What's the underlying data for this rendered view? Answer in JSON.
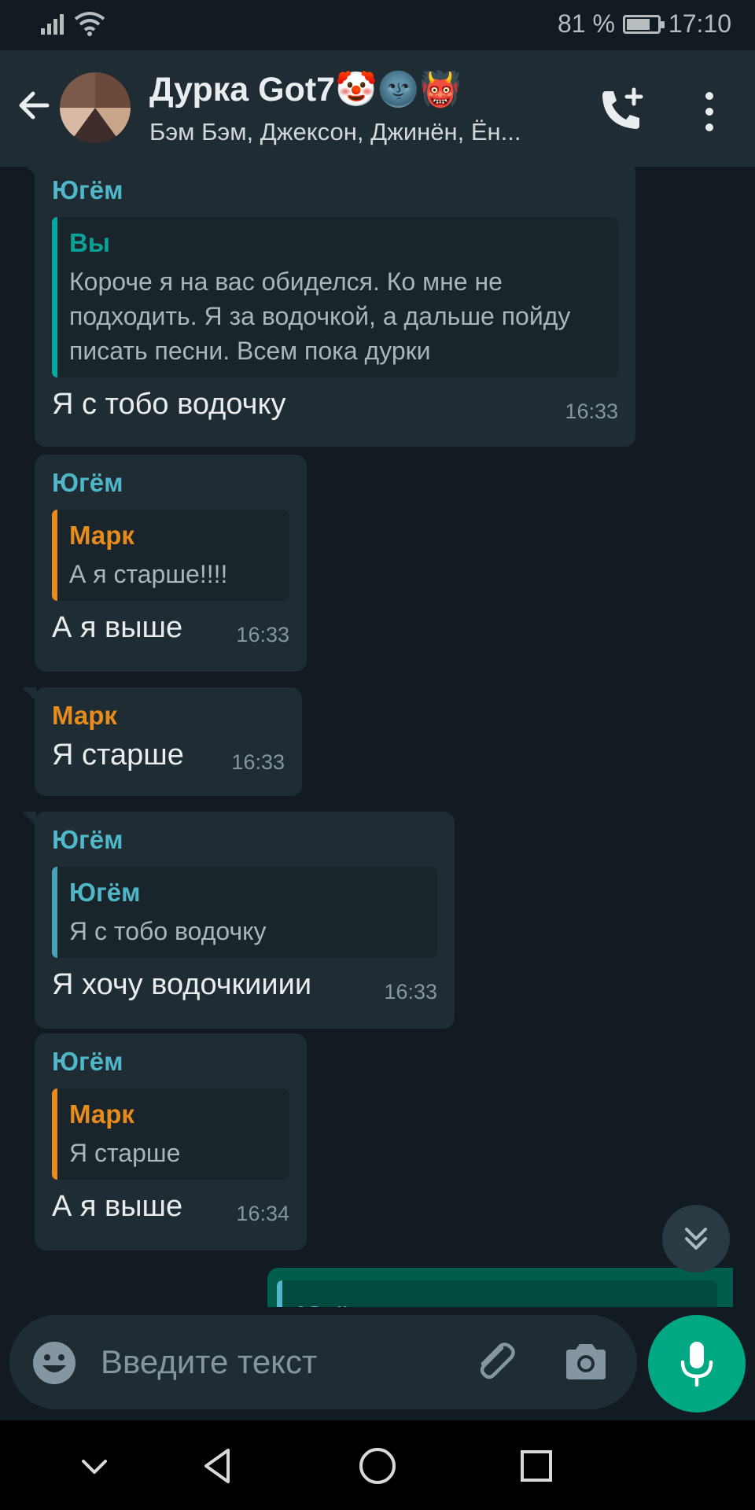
{
  "status_bar": {
    "battery": "81 %",
    "time": "17:10"
  },
  "header": {
    "title": "Дурка Got7🤡🌚👹",
    "subtitle": "Бэм Бэм, Джексон, Джинён, Ён..."
  },
  "messages": [
    {
      "sender": "Югём",
      "sender_color": "#4fb7c8",
      "quote_author": "Вы",
      "quote_text": "Короче я на вас обиделся. Ко мне не подходить. Я за водочкой, а дальше пойду писать песни. Всем пока дурки",
      "text": "Я с тобо водочку",
      "time": "16:33"
    },
    {
      "sender": "Югём",
      "quote_author": "Марк",
      "quote_text": "А я старше!!!!",
      "text": "А я выше",
      "time": "16:33"
    },
    {
      "sender": "Марк",
      "text": "Я старше",
      "time": "16:33"
    },
    {
      "sender": "Югём",
      "quote_author": "Югём",
      "quote_text": "Я с тобо водочку",
      "text": "Я хочу водочкииии",
      "time": "16:33"
    },
    {
      "sender": "Югём",
      "quote_author": "Марк",
      "quote_text": "Я старше",
      "text": "А я выше",
      "time": "16:34"
    }
  ],
  "outgoing_partial": {
    "quote_author": "Югём"
  },
  "composer": {
    "placeholder": "Введите текст"
  },
  "colors": {
    "background": "#121b22",
    "bar": "#1f2c34",
    "accent_green": "#00a884",
    "name_teal": "#0aa39a",
    "name_orange": "#e78b1c",
    "name_blue": "#4fb7c8"
  },
  "icons": [
    "back-arrow-icon",
    "add-call-icon",
    "more-vert-icon",
    "double-chevron-down-icon",
    "emoji-icon",
    "attach-icon",
    "camera-icon",
    "mic-icon",
    "nav-hide-icon",
    "nav-back-icon",
    "nav-home-icon",
    "nav-recents-icon"
  ]
}
